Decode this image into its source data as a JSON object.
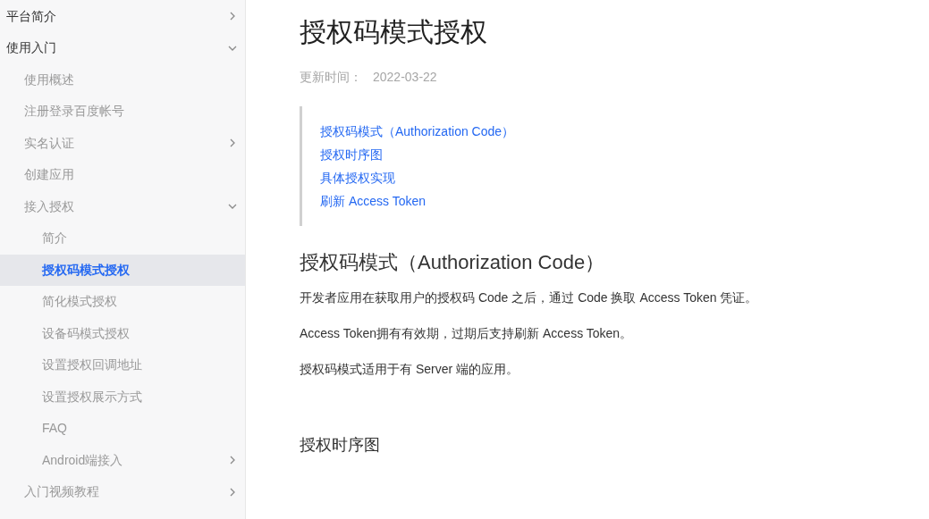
{
  "sidebar": {
    "items": [
      {
        "label": "平台简介",
        "expanded": false,
        "selected": false
      },
      {
        "label": "使用入门",
        "expanded": true,
        "selected": false,
        "children": [
          {
            "label": "使用概述",
            "selected": false
          },
          {
            "label": "注册登录百度帐号",
            "selected": false
          },
          {
            "label": "实名认证",
            "expanded": false,
            "selected": false
          },
          {
            "label": "创建应用",
            "selected": false
          },
          {
            "label": "接入授权",
            "expanded": true,
            "selected": false,
            "children": [
              {
                "label": "简介",
                "selected": false
              },
              {
                "label": "授权码模式授权",
                "selected": true
              },
              {
                "label": "简化模式授权",
                "selected": false
              },
              {
                "label": "设备码模式授权",
                "selected": false
              },
              {
                "label": "设置授权回调地址",
                "selected": false
              },
              {
                "label": "设置授权展示方式",
                "selected": false
              },
              {
                "label": "FAQ",
                "selected": false
              },
              {
                "label": "Android端接入",
                "expanded": false,
                "selected": false
              }
            ]
          },
          {
            "label": "入门视频教程",
            "expanded": false,
            "selected": false
          }
        ]
      }
    ]
  },
  "article": {
    "title": "授权码模式授权",
    "updated_label": "更新时间：",
    "updated_date": "2022-03-22",
    "toc": [
      "授权码模式（Authorization Code）",
      "授权时序图",
      "具体授权实现",
      "刷新 Access Token"
    ],
    "section_heading": "授权码模式（Authorization Code）",
    "paragraphs": [
      "开发者应用在获取用户的授权码 Code 之后，通过 Code 换取 Access Token 凭证。",
      "Access Token拥有有效期，过期后支持刷新 Access Token。",
      "授权码模式适用于有 Server 端的应用。"
    ],
    "subheading": "授权时序图"
  }
}
